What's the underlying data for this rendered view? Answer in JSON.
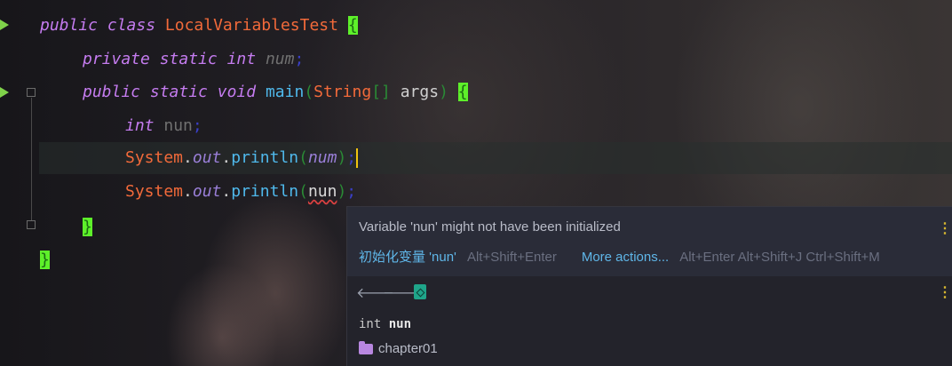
{
  "code": {
    "line1": {
      "kw1": "public",
      "kw2": "class",
      "name": "LocalVariablesTest",
      "brace": "{"
    },
    "line2": {
      "kw1": "private",
      "kw2": "static",
      "type": "int",
      "field": "num",
      "semi": ";"
    },
    "line3": {
      "kw1": "public",
      "kw2": "static",
      "kw3": "void",
      "method": "main",
      "lp": "(",
      "ptype": "String",
      "arr": "[]",
      "param": "args",
      "rp": ")",
      "brace": "{"
    },
    "line4": {
      "type": "int",
      "var": "nun",
      "semi": ";"
    },
    "line5": {
      "cls": "System",
      "dot1": ".",
      "out": "out",
      "dot2": ".",
      "call": "println",
      "lp": "(",
      "arg": "num",
      "rp": ")",
      "semi": ";"
    },
    "line6": {
      "cls": "System",
      "dot1": ".",
      "out": "out",
      "dot2": ".",
      "call": "println",
      "lp": "(",
      "arg": "nun",
      "rp": ")",
      "semi": ";"
    },
    "line7": {
      "brace": "}"
    },
    "line8": {
      "brace": "}"
    }
  },
  "popup": {
    "message": "Variable 'nun' might not have been initialized",
    "fix_label": "初始化变量 'nun'",
    "fix_shortcut": "Alt+Shift+Enter",
    "more_label": "More actions...",
    "more_shortcut": "Alt+Enter Alt+Shift+J Ctrl+Shift+M",
    "decl_type": "int",
    "decl_name": "nun",
    "package": "chapter01"
  },
  "icons": {
    "back": "arrow-left-icon",
    "forward": "arrow-right-icon",
    "file": "java-file-icon",
    "folder": "package-folder-icon",
    "kebab": "more-vertical-icon",
    "run": "run-arrow-icon"
  },
  "colors": {
    "accent": "#5ef02a",
    "keyword": "#c57cf0",
    "class": "#f26a3a",
    "link": "#5fb6e8"
  }
}
